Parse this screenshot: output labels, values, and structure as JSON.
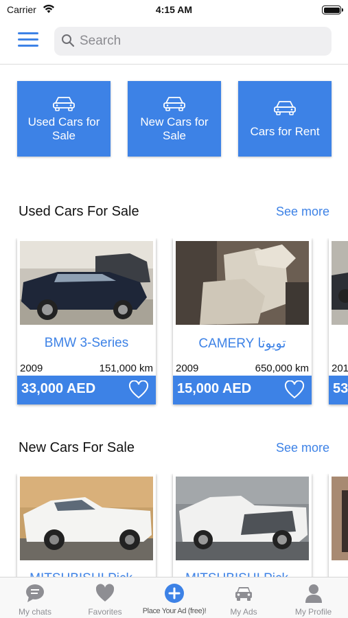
{
  "status_bar": {
    "carrier": "Carrier",
    "time": "4:15 AM"
  },
  "header": {
    "search_placeholder": "Search"
  },
  "categories": [
    {
      "label": "Used Cars for Sale"
    },
    {
      "label": "New Cars for Sale"
    },
    {
      "label": "Cars for Rent"
    }
  ],
  "sections": {
    "used": {
      "title": "Used Cars For Sale",
      "see_more": "See more"
    },
    "new": {
      "title": "New Cars For Sale",
      "see_more": "See more"
    }
  },
  "used_cars": [
    {
      "title": "BMW  3-Series",
      "year": "2009",
      "km": "151,000  km",
      "price": "33,000 AED"
    },
    {
      "title": "CAMERY  تويوتا",
      "year": "2009",
      "km": "650,000  km",
      "price": "15,000 AED"
    },
    {
      "year": "201",
      "price": "53"
    }
  ],
  "new_cars": [
    {
      "title": "MITSUBISHI  Pick..."
    },
    {
      "title": "MITSUBISHI  Pick..."
    }
  ],
  "tabs": [
    {
      "label": "My chats",
      "icon": "chat-icon"
    },
    {
      "label": "Favorites",
      "icon": "heart-icon"
    },
    {
      "label": "Place Your Ad (free)!",
      "icon": "plus-circle-icon"
    },
    {
      "label": "My Ads",
      "icon": "car-icon"
    },
    {
      "label": "My Profile",
      "icon": "person-icon"
    }
  ],
  "colors": {
    "accent": "#3d82e6",
    "tab_inactive": "#8e8e93"
  }
}
